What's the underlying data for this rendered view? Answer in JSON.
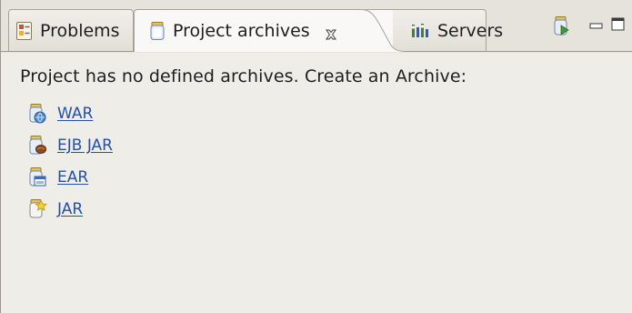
{
  "tabs": [
    {
      "label": "Problems",
      "icon": "problems-icon",
      "active": false
    },
    {
      "label": "Project archives",
      "icon": "archive-icon",
      "active": true,
      "closable": true
    },
    {
      "label": "Servers",
      "icon": "servers-icon",
      "active": false
    }
  ],
  "toolbar": {
    "new_archive_icon": "new-archive-icon",
    "minimize_icon": "minimize-icon",
    "maximize_icon": "maximize-icon"
  },
  "content": {
    "message": "Project has no defined archives. Create an Archive:",
    "links": [
      {
        "label": "WAR",
        "icon": "war-icon"
      },
      {
        "label": "EJB JAR",
        "icon": "ejb-jar-icon"
      },
      {
        "label": "EAR",
        "icon": "ear-icon"
      },
      {
        "label": "JAR",
        "icon": "jar-icon"
      }
    ]
  },
  "colors": {
    "link": "#2450a8",
    "background": "#efede8",
    "active_tab": "#f9f8f6"
  }
}
